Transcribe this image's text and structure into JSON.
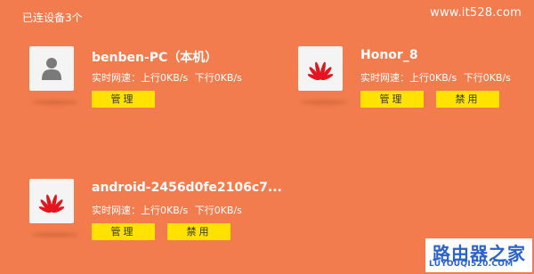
{
  "header": {
    "connected_devices_label": "已连设备3个",
    "watermark": "www.it528.com"
  },
  "devices": [
    {
      "name": "benben-PC（本机）",
      "icon": "user-icon",
      "speed_label": "实时网速：",
      "upload": "上行0KB/s",
      "download": "下行0KB/s",
      "manage_label": "管理"
    },
    {
      "name": "Honor_8",
      "icon": "huawei-logo-icon",
      "speed_label": "实时网速：",
      "upload": "上行0KB/s",
      "download": "下行0KB/s",
      "manage_label": "管理",
      "ban_label": "禁用"
    },
    {
      "name": "android-2456d0fe2106c7...",
      "icon": "huawei-logo-icon",
      "speed_label": "实时网速：",
      "upload": "上行0KB/s",
      "download": "下行0KB/s",
      "manage_label": "管理",
      "ban_label": "禁用"
    }
  ],
  "watermark_logo": {
    "main": "路由器之家",
    "sub": "LUYOUQI520.COM"
  },
  "colors": {
    "background": "#F27C4E",
    "button": "#FFE200",
    "huawei_red": "#E6141E"
  }
}
